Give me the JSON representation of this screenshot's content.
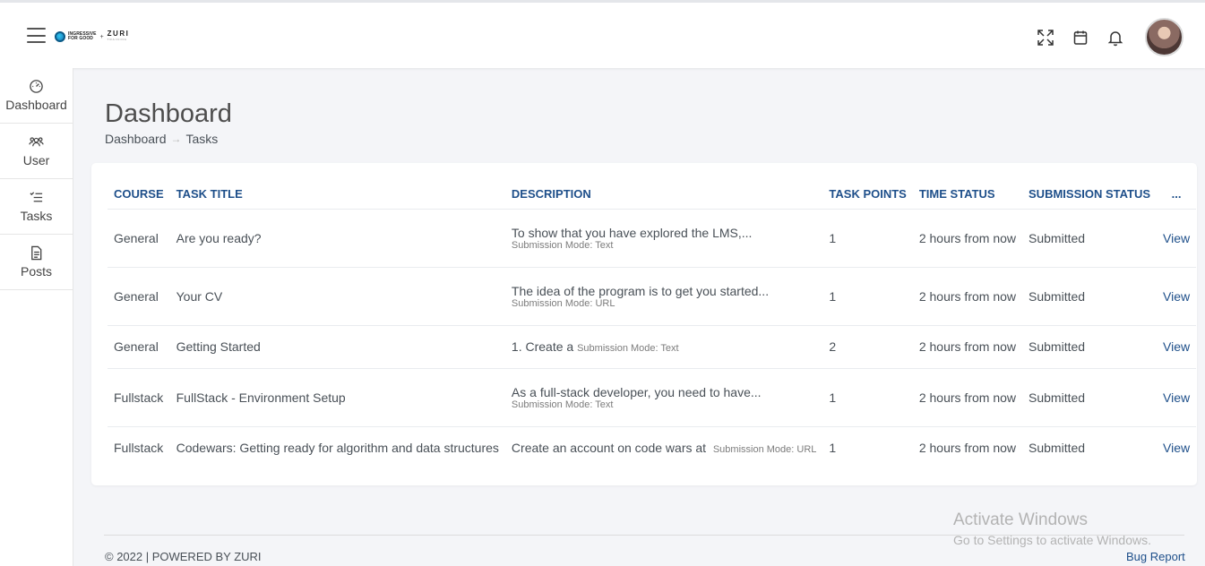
{
  "topbar": {
    "logo": {
      "line1": "INGRESSIVE",
      "line2": "FOR GOOD",
      "plus": "+",
      "zuri": "ZURI",
      "zuri_sub": "TRAINING"
    },
    "icons": [
      "fullscreen-icon",
      "calendar-icon",
      "bell-icon"
    ]
  },
  "sidebar": {
    "items": [
      {
        "label": "Dashboard",
        "icon": "dashboard-gauge-icon"
      },
      {
        "label": "User",
        "icon": "users-icon"
      },
      {
        "label": "Tasks",
        "icon": "tasks-list-icon"
      },
      {
        "label": "Posts",
        "icon": "document-icon"
      }
    ]
  },
  "page": {
    "title": "Dashboard",
    "breadcrumb": [
      "Dashboard",
      "Tasks"
    ],
    "breadcrumb_sep": "→"
  },
  "table": {
    "headers": [
      "COURSE",
      "TASK TITLE",
      "DESCRIPTION",
      "TASK POINTS",
      "TIME STATUS",
      "SUBMISSION STATUS",
      "..."
    ],
    "rows": [
      {
        "course": "General",
        "title": "Are you ready?",
        "desc": "To show that you have explored the LMS,...",
        "mode": "Submission Mode: Text",
        "points": "1",
        "time": "2 hours from now",
        "status": "Submitted",
        "action": "View"
      },
      {
        "course": "General",
        "title": "Your CV",
        "desc": "The idea of the program is to get you started...",
        "mode": "Submission Mode: URL",
        "points": "1",
        "time": "2 hours from now",
        "status": "Submitted",
        "action": "View"
      },
      {
        "course": "General",
        "title": "Getting Started",
        "desc": "1. Create a",
        "mode": "Submission Mode: Text",
        "points": "2",
        "time": "2 hours from now",
        "status": "Submitted",
        "action": "View"
      },
      {
        "course": "Fullstack",
        "title": "FullStack - Environment Setup",
        "desc": "As a full-stack developer, you need to have...",
        "mode": "Submission Mode: Text",
        "points": "1",
        "time": "2 hours from now",
        "status": "Submitted",
        "action": "View"
      },
      {
        "course": "Fullstack",
        "title": "Codewars: Getting ready for algorithm and data structures",
        "desc": "Create an account on code wars at",
        "mode": "Submission Mode: URL",
        "points": "1",
        "time": "2 hours from now",
        "status": "Submitted",
        "action": "View"
      }
    ]
  },
  "footer": {
    "copyright": "© 2022 | POWERED BY ZURI",
    "bug_report": "Bug Report"
  },
  "watermark": {
    "line1": "Activate Windows",
    "line2": "Go to Settings to activate Windows."
  },
  "colors": {
    "accent": "#1e4f8a",
    "background": "#f4f5f8"
  }
}
